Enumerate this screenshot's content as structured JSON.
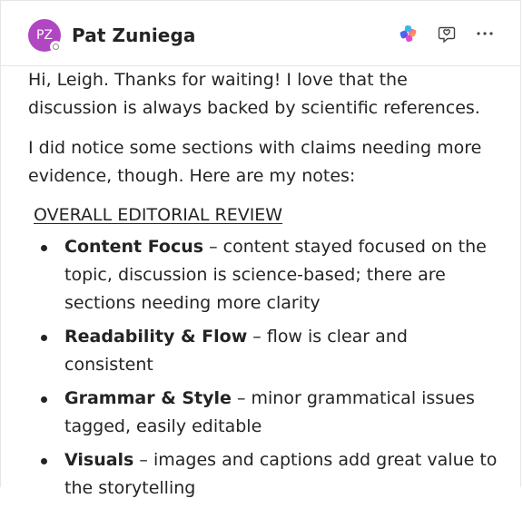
{
  "message": {
    "author": {
      "initials": "PZ",
      "name": "Pat Zuniega",
      "avatar_color": "#b146c2",
      "presence": "offline"
    },
    "header_icons": [
      "copilot-icon",
      "react-icon",
      "more-options-icon"
    ],
    "paragraphs": [
      "Hi, Leigh. Thanks for waiting! I love that the discussion is always backed by scientific references.",
      "I did notice some sections with claims needing more evidence, though. Here are my notes:"
    ],
    "review_heading": "OVERALL EDITORIAL REVIEW",
    "notes": [
      {
        "term": "Content Focus",
        "text": " – content stayed focused on the topic, discussion is science-based; there are sections needing more clarity"
      },
      {
        "term": "Readability & Flow",
        "text": " – flow is clear and consistent"
      },
      {
        "term": "Grammar & Style",
        "text": " – minor grammatical issues tagged, easily editable"
      },
      {
        "term": "Visuals",
        "text": " – images and captions add great value to the storytelling"
      }
    ]
  }
}
